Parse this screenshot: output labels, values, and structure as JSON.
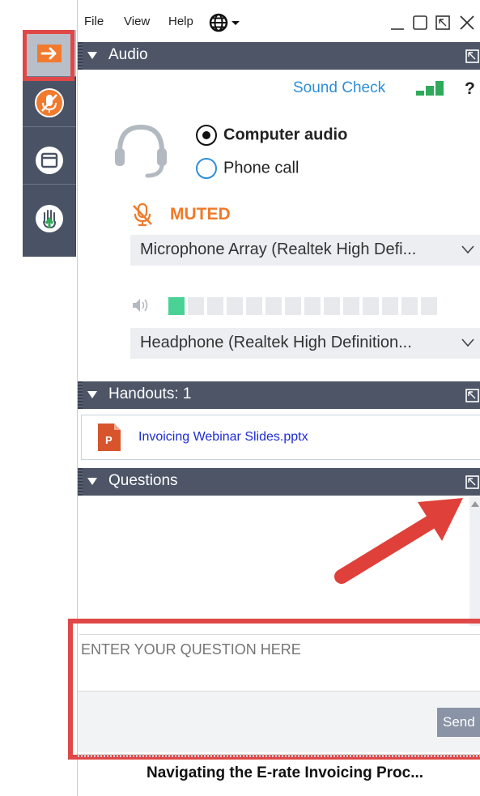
{
  "toolbar": {
    "items": [
      {
        "name": "show-hide-control-panel",
        "icon": "arrow-right-icon"
      },
      {
        "name": "microphone",
        "icon": "mic-muted-icon"
      },
      {
        "name": "screen",
        "icon": "window-icon"
      },
      {
        "name": "raise-hand",
        "icon": "hand-icon"
      }
    ],
    "highlight_color": "#e04848"
  },
  "menubar": {
    "items": [
      "File",
      "View",
      "Help"
    ],
    "language_icon": "globe-icon",
    "controls": [
      "minimize-icon",
      "restore-icon",
      "popout-icon",
      "close-icon"
    ]
  },
  "audio": {
    "header": "Audio",
    "sound_check": "Sound Check",
    "help": "?",
    "options": {
      "computer": "Computer audio",
      "phone": "Phone call",
      "selected": "computer"
    },
    "muted_label": "MUTED",
    "microphone_device": "Microphone Array (Realtek High Defi...",
    "speaker_level_segments_on": 1,
    "speaker_level_segments_total": 14,
    "speaker_device": "Headphone (Realtek High Definition..."
  },
  "handouts": {
    "header": "Handouts: 1",
    "file": "Invoicing Webinar Slides.pptx",
    "file_icon": "powerpoint-icon",
    "file_icon_letter": "P"
  },
  "questions": {
    "header": "Questions",
    "input_placeholder": "ENTER YOUR QUESTION HERE",
    "send_label": "Send"
  },
  "footer": {
    "webinar_title": "Navigating the E-rate Invoicing Proc..."
  },
  "colors": {
    "header_bg": "#4d5567",
    "accent_blue": "#2d8fd8",
    "muted_orange": "#ef7a2a",
    "level_green": "#49d196",
    "annotation_red": "#e04848"
  }
}
